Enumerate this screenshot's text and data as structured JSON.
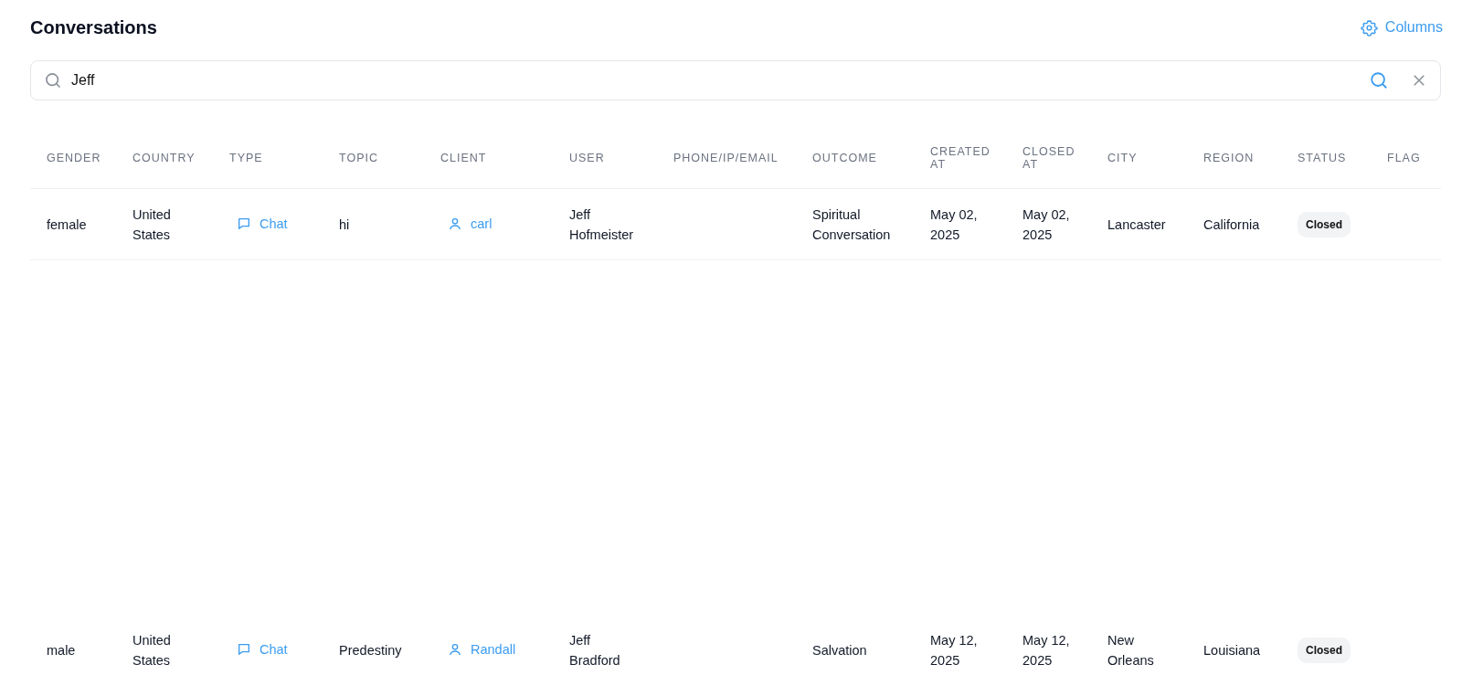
{
  "title": "Conversations",
  "columns_button": "Columns",
  "search": {
    "value": "Jeff"
  },
  "table": {
    "columns": [
      "GENDER",
      "COUNTRY",
      "TYPE",
      "TOPIC",
      "CLIENT",
      "USER",
      "PHONE/IP/EMAIL",
      "OUTCOME",
      "CREATED AT",
      "CLOSED AT",
      "CITY",
      "REGION",
      "STATUS",
      "FLAG"
    ],
    "rows": [
      {
        "gender": "female",
        "country": "United States",
        "type": "Chat",
        "topic": "hi",
        "client": "carl",
        "user": "Jeff Hofmeister",
        "outcome": "Spiritual Conversation",
        "created_at": "May 02, 2025",
        "closed_at": "May 02, 2025",
        "city": "Lancaster",
        "region": "California",
        "status": "Closed"
      },
      {
        "gender": "male",
        "country": "United States",
        "type": "Chat",
        "topic": "Predestiny",
        "client": "Randall",
        "user": "Jeff Bradford",
        "outcome": "Salvation",
        "created_at": "May 12, 2025",
        "closed_at": "May 12, 2025",
        "city": "New Orleans",
        "region": "Louisiana",
        "status": "Closed"
      }
    ]
  }
}
